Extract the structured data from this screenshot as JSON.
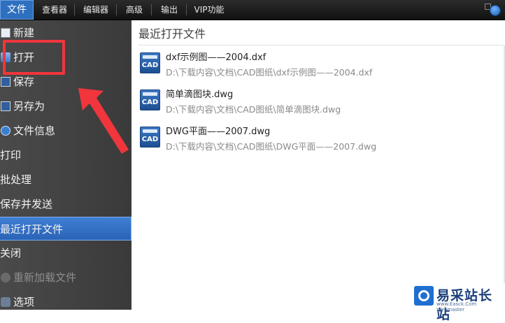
{
  "menubar": {
    "items": [
      {
        "label": "文件",
        "active": true
      },
      {
        "label": "查看器"
      },
      {
        "label": "编辑器"
      },
      {
        "label": "高级"
      },
      {
        "label": "输出"
      },
      {
        "label": "VIP功能"
      }
    ]
  },
  "left_panel": {
    "items": [
      {
        "label": "新建",
        "icon": "new-file-icon"
      },
      {
        "label": "打开",
        "icon": "open-folder-icon"
      },
      {
        "label": "保存",
        "icon": "save-icon"
      },
      {
        "label": "另存为",
        "icon": "save-as-icon"
      },
      {
        "label": "文件信息",
        "icon": "info-icon"
      },
      {
        "label": "打印"
      },
      {
        "label": "批处理"
      },
      {
        "label": "保存并发送"
      },
      {
        "label": "最近打开文件",
        "selected": true
      },
      {
        "label": "关闭"
      },
      {
        "label": "重新加载文件",
        "icon": "reload-icon",
        "disabled": true
      },
      {
        "label": "选项",
        "icon": "options-icon"
      }
    ]
  },
  "main": {
    "title": "最近打开文件",
    "icon_label": "CAD",
    "files": [
      {
        "name": "dxf示例图——2004.dxf",
        "path": "D:\\下载内容\\文档\\CAD图纸\\dxf示例图——2004.dxf"
      },
      {
        "name": "简单滴图块.dwg",
        "path": "D:\\下载内容\\文档\\CAD图纸\\简单滴图块.dwg"
      },
      {
        "name": "DWG平面——2007.dwg",
        "path": "D:\\下载内容\\文档\\CAD图纸\\DWG平面——2007.dwg"
      }
    ]
  },
  "watermark": {
    "text": "易采站长站",
    "sub": "www.Easck.Com Webmaster"
  },
  "colors": {
    "accent": "#2e6fbf",
    "highlight_red": "#f0353c",
    "panel_bg": "#404040"
  }
}
